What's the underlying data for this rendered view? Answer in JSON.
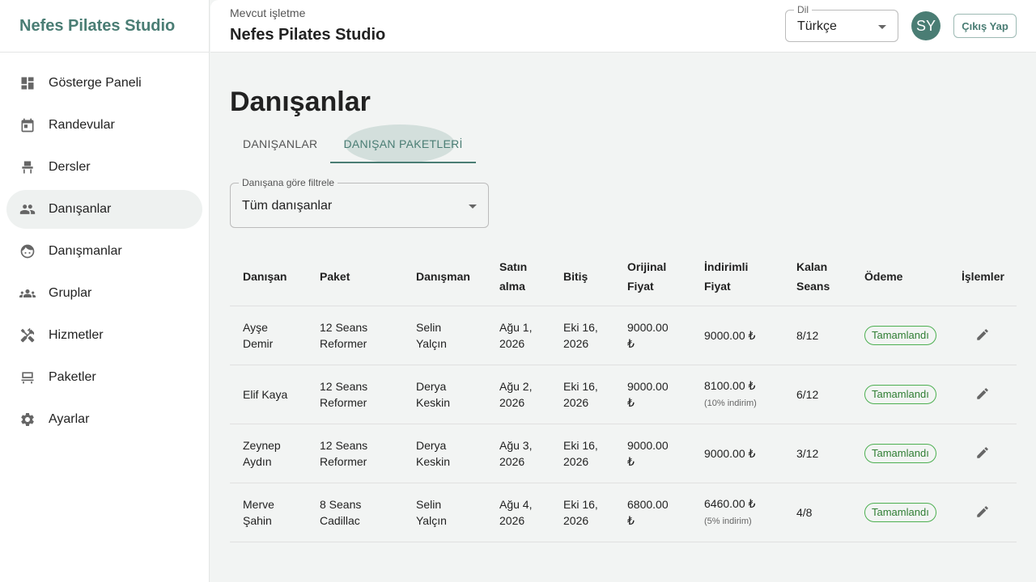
{
  "sidebar": {
    "brand": "Nefes Pilates Studio",
    "items": [
      {
        "label": "Gösterge Paneli",
        "icon": "dashboard-icon"
      },
      {
        "label": "Randevular",
        "icon": "calendar-icon"
      },
      {
        "label": "Dersler",
        "icon": "chair-icon"
      },
      {
        "label": "Danışanlar",
        "icon": "people-icon",
        "active": true
      },
      {
        "label": "Danışmanlar",
        "icon": "face-icon"
      },
      {
        "label": "Gruplar",
        "icon": "groups-icon"
      },
      {
        "label": "Hizmetler",
        "icon": "tools-icon"
      },
      {
        "label": "Paketler",
        "icon": "bench-icon"
      },
      {
        "label": "Ayarlar",
        "icon": "gear-icon"
      }
    ]
  },
  "header": {
    "business_caption": "Mevcut işletme",
    "business_name": "Nefes Pilates Studio",
    "language_label": "Dil",
    "language_value": "Türkçe",
    "avatar_initials": "SY",
    "logout_label": "Çıkış Yap"
  },
  "main": {
    "title": "Danışanlar",
    "tabs": [
      {
        "label": "DANIŞANLAR"
      },
      {
        "label": "DANIŞAN PAKETLERİ"
      }
    ],
    "filter": {
      "label": "Danışana göre filtrele",
      "value": "Tüm danışanlar"
    },
    "table": {
      "columns": [
        "Danışan",
        "Paket",
        "Danışman",
        "Satın alma",
        "Bitiş",
        "Orijinal Fiyat",
        "İndirimli Fiyat",
        "Kalan Seans",
        "Ödeme",
        "İşlemler"
      ],
      "rows": [
        {
          "client": "Ayşe Demir",
          "package": "12 Seans Reformer",
          "consultant": "Selin Yalçın",
          "purchase": "Ağu 1, 2026",
          "end": "Eki 16, 2026",
          "original": "9000.00 ₺",
          "discounted": "9000.00 ₺",
          "discount_note": "",
          "remaining": "8/12",
          "payment": "Tamamlandı"
        },
        {
          "client": "Elif Kaya",
          "package": "12 Seans Reformer",
          "consultant": "Derya Keskin",
          "purchase": "Ağu 2, 2026",
          "end": "Eki 16, 2026",
          "original": "9000.00 ₺",
          "discounted": "8100.00 ₺",
          "discount_note": "(10% indirim)",
          "remaining": "6/12",
          "payment": "Tamamlandı"
        },
        {
          "client": "Zeynep Aydın",
          "package": "12 Seans Reformer",
          "consultant": "Derya Keskin",
          "purchase": "Ağu 3, 2026",
          "end": "Eki 16, 2026",
          "original": "9000.00 ₺",
          "discounted": "9000.00 ₺",
          "discount_note": "",
          "remaining": "3/12",
          "payment": "Tamamlandı"
        },
        {
          "client": "Merve Şahin",
          "package": "8 Seans Cadillac",
          "consultant": "Selin Yalçın",
          "purchase": "Ağu 4, 2026",
          "end": "Eki 16, 2026",
          "original": "6800.00 ₺",
          "discounted": "6460.00 ₺",
          "discount_note": "(5% indirim)",
          "remaining": "4/8",
          "payment": "Tamamlandı"
        }
      ]
    }
  },
  "colors": {
    "accent": "#4a7d74",
    "success": "#2e7d32"
  }
}
